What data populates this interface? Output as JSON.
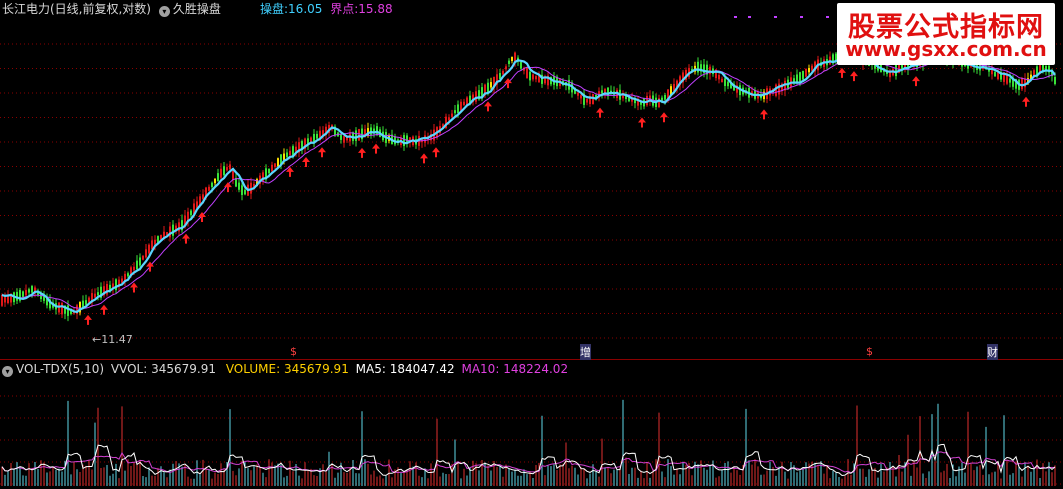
{
  "header": {
    "stock_name": "长江电力(日线,前复权,对数)",
    "indicator_name": "久胜操盘",
    "caopan_label": "操盘:",
    "caopan_value": "16.05",
    "jiedian_label": "界点:",
    "jiedian_value": "15.88"
  },
  "volume_header": {
    "indicator": "VOL-TDX(5,10)",
    "vvol_label": "VVOL:",
    "vvol_value": "345679.91",
    "volume_label": "VOLUME:",
    "volume_value": "345679.91",
    "ma5_label": "MA5:",
    "ma5_value": "184047.42",
    "ma10_label": "MA10:",
    "ma10_value": "148224.02"
  },
  "watermark": {
    "title": "股票公式指标网",
    "url": "www.gsxx.com.cn"
  },
  "events": {
    "s1": "$",
    "zeng": "增",
    "s2": "$",
    "cai": "财"
  },
  "low_marker": "11.47",
  "colors": {
    "background": "#000000",
    "rise": "#e01818",
    "fall": "#39e339",
    "caopan_line": "#5ad6ff",
    "jiedian_line": "#c040ff",
    "signal_arrow": "#ff2020",
    "caopan_text": "#40d0ff",
    "jiedian_text": "#e040e0",
    "grid": "#8a0000",
    "ma5": "#ffffff",
    "ma10": "#d040d0",
    "bar_up": "#e03030",
    "bar_down": "#60d8e8"
  },
  "chart_data": {
    "type": "candlestick-with-volume",
    "price_scale": "log",
    "ylim": [
      11.0,
      17.2
    ],
    "series_shape": [
      [
        0,
        11.65
      ],
      [
        12,
        11.7
      ],
      [
        22,
        11.75
      ],
      [
        33,
        11.85
      ],
      [
        42,
        11.72
      ],
      [
        50,
        11.6
      ],
      [
        58,
        11.55
      ],
      [
        66,
        11.5
      ],
      [
        74,
        11.47
      ],
      [
        84,
        11.6
      ],
      [
        96,
        11.75
      ],
      [
        108,
        11.85
      ],
      [
        120,
        11.95
      ],
      [
        132,
        12.15
      ],
      [
        142,
        12.35
      ],
      [
        152,
        12.6
      ],
      [
        162,
        12.75
      ],
      [
        172,
        12.85
      ],
      [
        182,
        12.95
      ],
      [
        190,
        13.15
      ],
      [
        198,
        13.35
      ],
      [
        206,
        13.55
      ],
      [
        214,
        13.75
      ],
      [
        222,
        13.95
      ],
      [
        230,
        14.05
      ],
      [
        236,
        13.75
      ],
      [
        244,
        13.55
      ],
      [
        252,
        13.65
      ],
      [
        260,
        13.8
      ],
      [
        268,
        13.95
      ],
      [
        276,
        14.1
      ],
      [
        284,
        14.25
      ],
      [
        292,
        14.35
      ],
      [
        300,
        14.45
      ],
      [
        308,
        14.55
      ],
      [
        316,
        14.65
      ],
      [
        324,
        14.75
      ],
      [
        332,
        14.85
      ],
      [
        338,
        14.7
      ],
      [
        344,
        14.6
      ],
      [
        352,
        14.65
      ],
      [
        360,
        14.7
      ],
      [
        368,
        14.75
      ],
      [
        376,
        14.8
      ],
      [
        384,
        14.65
      ],
      [
        392,
        14.6
      ],
      [
        400,
        14.55
      ],
      [
        408,
        14.6
      ],
      [
        416,
        14.55
      ],
      [
        424,
        14.6
      ],
      [
        432,
        14.65
      ],
      [
        440,
        14.8
      ],
      [
        448,
        15.0
      ],
      [
        456,
        15.2
      ],
      [
        464,
        15.35
      ],
      [
        472,
        15.45
      ],
      [
        480,
        15.55
      ],
      [
        488,
        15.7
      ],
      [
        496,
        15.85
      ],
      [
        504,
        16.05
      ],
      [
        510,
        16.3
      ],
      [
        516,
        16.4
      ],
      [
        522,
        16.15
      ],
      [
        530,
        15.95
      ],
      [
        538,
        15.9
      ],
      [
        546,
        15.85
      ],
      [
        554,
        15.85
      ],
      [
        562,
        15.8
      ],
      [
        570,
        15.75
      ],
      [
        578,
        15.55
      ],
      [
        586,
        15.4
      ],
      [
        594,
        15.45
      ],
      [
        602,
        15.6
      ],
      [
        610,
        15.6
      ],
      [
        618,
        15.55
      ],
      [
        626,
        15.5
      ],
      [
        634,
        15.4
      ],
      [
        642,
        15.35
      ],
      [
        650,
        15.45
      ],
      [
        658,
        15.35
      ],
      [
        666,
        15.5
      ],
      [
        674,
        15.7
      ],
      [
        682,
        15.9
      ],
      [
        690,
        16.05
      ],
      [
        698,
        16.15
      ],
      [
        706,
        16.1
      ],
      [
        714,
        16.05
      ],
      [
        722,
        15.85
      ],
      [
        730,
        15.75
      ],
      [
        738,
        15.65
      ],
      [
        746,
        15.6
      ],
      [
        754,
        15.55
      ],
      [
        762,
        15.5
      ],
      [
        770,
        15.6
      ],
      [
        778,
        15.65
      ],
      [
        786,
        15.75
      ],
      [
        794,
        15.85
      ],
      [
        802,
        15.95
      ],
      [
        810,
        16.1
      ],
      [
        818,
        16.2
      ],
      [
        826,
        16.25
      ],
      [
        834,
        16.35
      ],
      [
        842,
        16.45
      ],
      [
        850,
        16.4
      ],
      [
        858,
        16.35
      ],
      [
        866,
        16.3
      ],
      [
        874,
        16.25
      ],
      [
        882,
        16.1
      ],
      [
        890,
        16.0
      ],
      [
        898,
        16.1
      ],
      [
        906,
        16.2
      ],
      [
        914,
        16.25
      ],
      [
        922,
        16.3
      ],
      [
        930,
        16.35
      ],
      [
        938,
        16.4
      ],
      [
        946,
        16.35
      ],
      [
        954,
        16.3
      ],
      [
        962,
        16.25
      ],
      [
        970,
        16.2
      ],
      [
        978,
        16.2
      ],
      [
        986,
        16.15
      ],
      [
        994,
        16.0
      ],
      [
        1002,
        15.95
      ],
      [
        1010,
        15.85
      ],
      [
        1018,
        15.75
      ],
      [
        1026,
        15.8
      ],
      [
        1034,
        16.0
      ],
      [
        1042,
        16.15
      ],
      [
        1050,
        16.1
      ],
      [
        1056,
        15.8
      ]
    ],
    "vol_ylim": [
      0,
      600000
    ],
    "signal_arrow_x": [
      88,
      104,
      134,
      150,
      186,
      202,
      228,
      290,
      306,
      322,
      362,
      376,
      424,
      436,
      488,
      508,
      600,
      642,
      664,
      764,
      842,
      854,
      916,
      1026
    ]
  }
}
